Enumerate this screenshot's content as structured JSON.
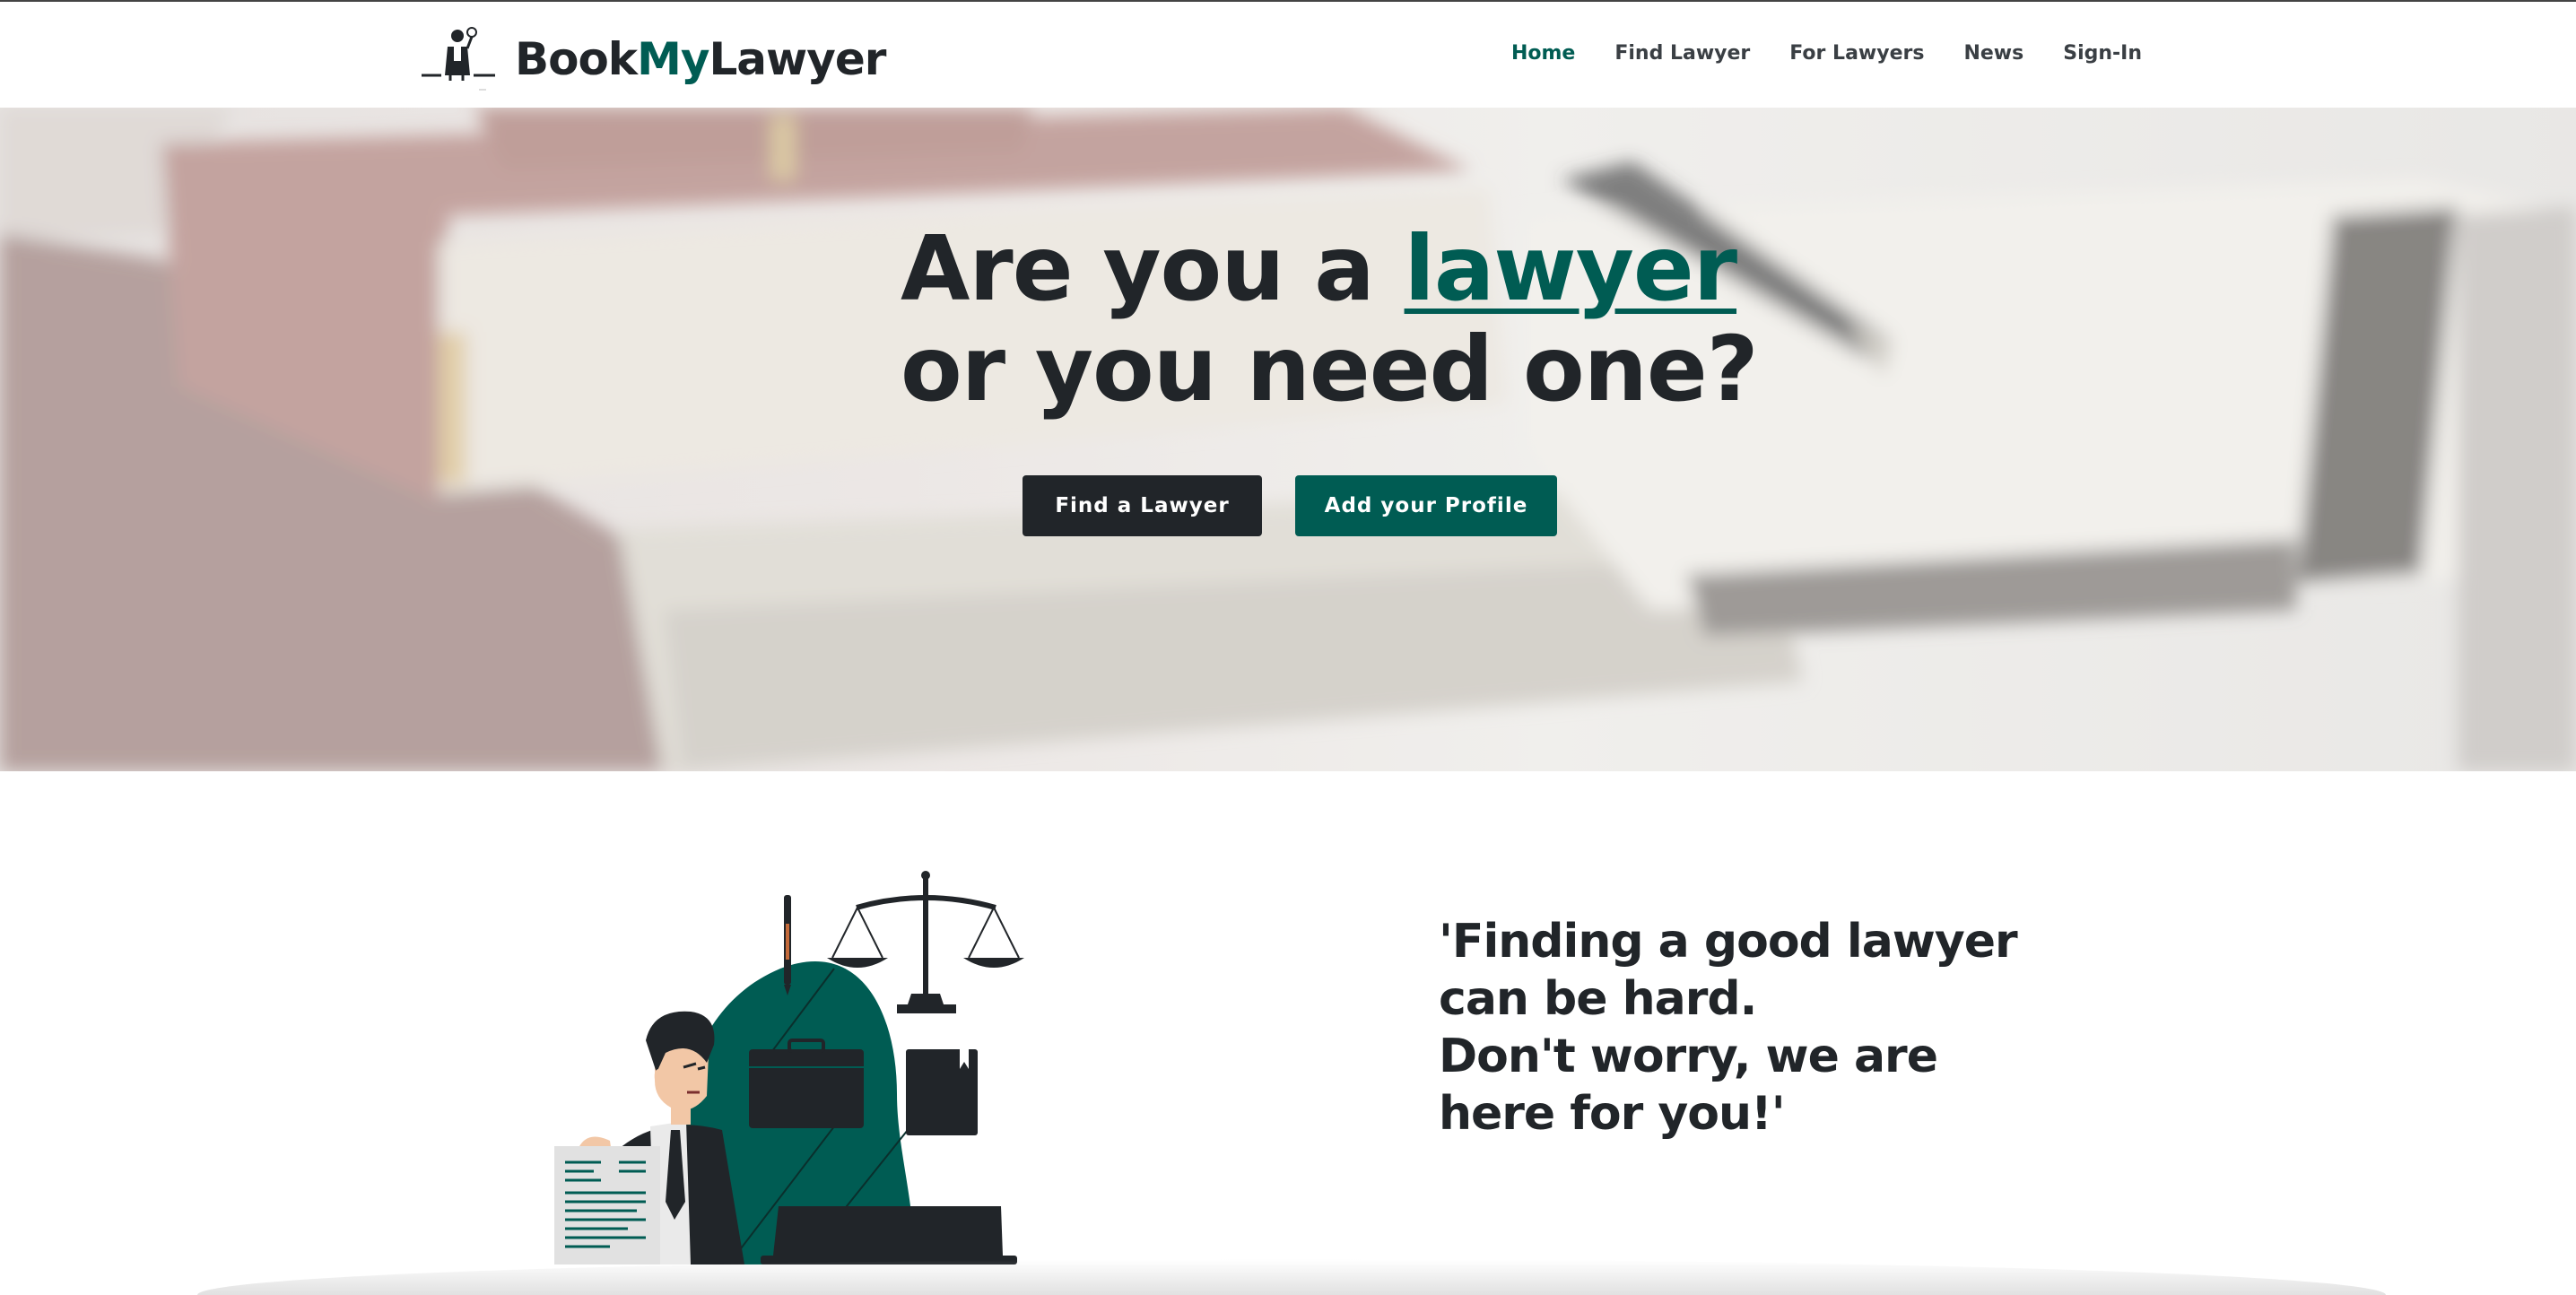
{
  "brand": {
    "name_part1": "Book",
    "name_part2": "My",
    "name_part3": "Lawyer",
    "accent_color": "#005c53",
    "logo_icon": "lawyer-figure-logo"
  },
  "nav": {
    "items": [
      {
        "label": "Home",
        "active": true
      },
      {
        "label": "Find Lawyer",
        "active": false
      },
      {
        "label": "For Lawyers",
        "active": false
      },
      {
        "label": "News",
        "active": false
      },
      {
        "label": "Sign-In",
        "active": false
      }
    ]
  },
  "hero": {
    "title_line1_prefix": "Are you a ",
    "title_line1_accent": "lawyer",
    "title_line2": "or you need one?",
    "primary_button": "Find a Lawyer",
    "secondary_button": "Add your Profile",
    "background": "books-and-pen-photo"
  },
  "intro": {
    "quote_lines": [
      "'Finding a good lawyer",
      "can be hard.",
      "Don't worry, we are",
      "here for you!'"
    ],
    "illustration": "lawyer-with-scales-illustration"
  },
  "colors": {
    "dark": "#212529",
    "teal": "#005c53",
    "white": "#ffffff"
  }
}
